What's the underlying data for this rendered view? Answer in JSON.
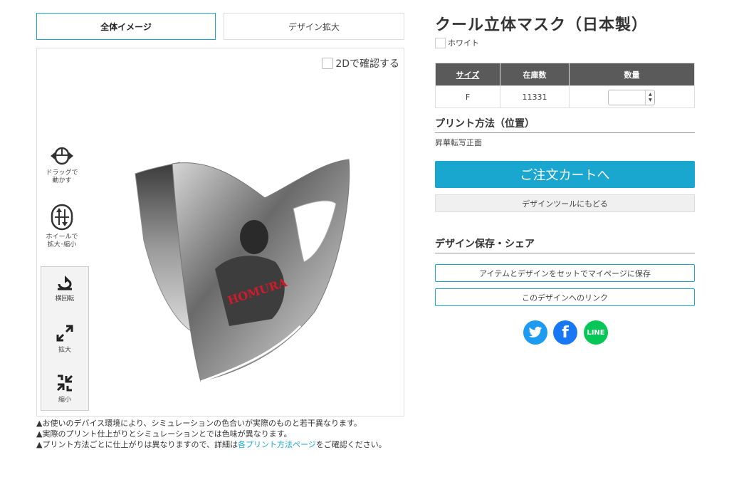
{
  "tabs": {
    "overall": "全体イメージ",
    "zoom": "デザイン拡大"
  },
  "viewer": {
    "check_2d": "2Dで確認する",
    "drag": [
      "ドラッグで",
      "動かす"
    ],
    "wheel": [
      "ホイールで",
      "拡大･縮小"
    ],
    "rotate": "横回転",
    "enlarge": "拡大",
    "shrink": "縮小",
    "mask_print_text": "HOMURA"
  },
  "notes": {
    "n1": "お使いのデバイス環境により、シミュレーションの色合いが実際のものと若干異なります。",
    "n2": "実際のプリント仕上がりとシミュレーションとでは色味が異なります。",
    "n3_pre": "プリント方法ごとに仕上がりは異なりますので、詳細は",
    "n3_link": "各プリント方法ページ",
    "n3_post": "をご確認ください。"
  },
  "product": {
    "title": "クール立体マスク（日本製）",
    "color": "ホワイト"
  },
  "stock_table": {
    "headers": [
      "サイズ",
      "在庫数",
      "数量"
    ],
    "rows": [
      {
        "size": "F",
        "stock": "11331",
        "qty": ""
      }
    ]
  },
  "print_method": {
    "heading": "プリント方法（位置）",
    "value": "昇華転写正面"
  },
  "buttons": {
    "cart": "ご注文カートへ",
    "back": "デザインツールにもどる",
    "save": "アイテムとデザインをセットでマイページに保存",
    "link": "このデザインへのリンク"
  },
  "share": {
    "heading": "デザイン保存・シェア",
    "line_label": "LINE"
  },
  "colors": {
    "accent": "#1aa7cf",
    "twitter": "#1d9bf0",
    "facebook": "#1877f2",
    "line": "#06c755"
  }
}
